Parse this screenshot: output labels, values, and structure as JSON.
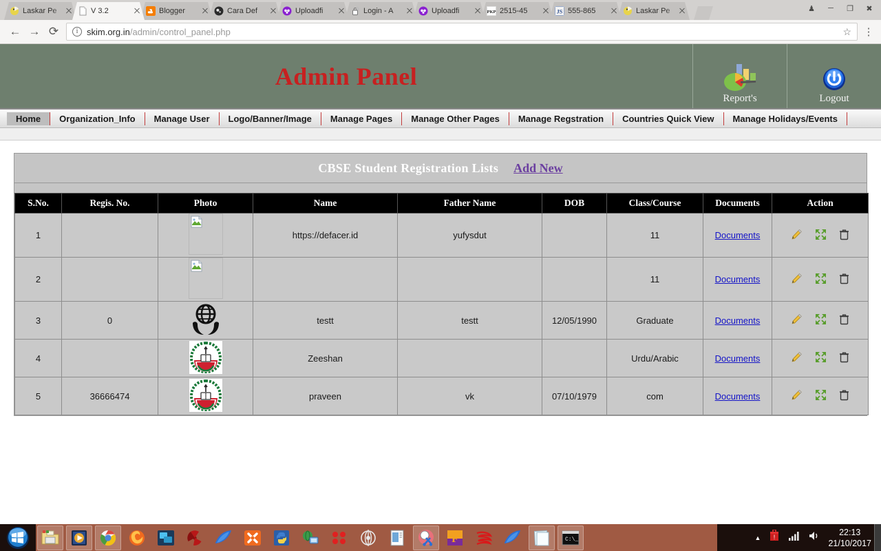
{
  "browser": {
    "tabs": [
      {
        "title": "Laskar Pe",
        "favicon": "laskar-icon",
        "active": false
      },
      {
        "title": "V 3.2",
        "favicon": "document-icon",
        "active": true
      },
      {
        "title": "Blogger",
        "favicon": "blogger-icon",
        "active": false
      },
      {
        "title": "Cara Def",
        "favicon": "dark-circle-icon",
        "active": false
      },
      {
        "title": "Uploadfi",
        "favicon": "uploadfiles-icon",
        "active": false
      },
      {
        "title": "Login - A",
        "favicon": "lock-icon",
        "active": false
      },
      {
        "title": "Uploadfi",
        "favicon": "uploadfiles-icon",
        "active": false
      },
      {
        "title": "2515-45",
        "favicon": "pkp-icon",
        "active": false
      },
      {
        "title": "555-865",
        "favicon": "js-icon",
        "active": false
      },
      {
        "title": "Laskar Pe",
        "favicon": "laskar-icon",
        "active": false
      }
    ],
    "window_controls": [
      "profile-icon",
      "minimize-icon",
      "maximize-icon",
      "close-icon"
    ],
    "nav": {
      "back": "←",
      "forward": "→",
      "reload": "⟳"
    },
    "omnibox": {
      "host": "skim.org.in",
      "path": "/admin/control_panel.php",
      "info_glyph": "i",
      "star_glyph": "☆"
    },
    "menu_glyph": "⋮"
  },
  "site": {
    "title": "Admin Panel",
    "header_buttons": [
      {
        "label": "Report's",
        "icon": "report-chart-icon"
      },
      {
        "label": "Logout",
        "icon": "power-icon"
      }
    ],
    "nav_items": [
      {
        "label": "Home",
        "active": true
      },
      {
        "label": "Organization_Info",
        "active": false
      },
      {
        "label": "Manage User",
        "active": false
      },
      {
        "label": "Logo/Banner/Image",
        "active": false
      },
      {
        "label": "Manage Pages",
        "active": false
      },
      {
        "label": "Manage Other Pages",
        "active": false
      },
      {
        "label": "Manage Regstration",
        "active": false
      },
      {
        "label": "Countries Quick View",
        "active": false
      },
      {
        "label": "Manage Holidays/Events",
        "active": false
      }
    ]
  },
  "panel": {
    "title": "CBSE Student Registration Lists",
    "add_new_label": "Add New"
  },
  "table": {
    "headers": [
      "S.No.",
      "Regis. No.",
      "Photo",
      "Name",
      "Father Name",
      "DOB",
      "Class/Course",
      "Documents",
      "Action"
    ],
    "docs_label": "Documents",
    "rows": [
      {
        "sno": "1",
        "regno": "",
        "photo": "broken-image",
        "name": "https://defacer.id",
        "father": "yufysdut",
        "dob": "",
        "class": "11"
      },
      {
        "sno": "2",
        "regno": "",
        "photo": "broken-image",
        "name": "",
        "father": "",
        "dob": "",
        "class": "11"
      },
      {
        "sno": "3",
        "regno": "0",
        "photo": "globe-hands-logo",
        "name": "testt",
        "father": "testt",
        "dob": "12/05/1990",
        "class": "Graduate"
      },
      {
        "sno": "4",
        "regno": "",
        "photo": "emblem-logo",
        "name": "Zeeshan",
        "father": "",
        "dob": "",
        "class": "Urdu/Arabic"
      },
      {
        "sno": "5",
        "regno": "36666474",
        "photo": "emblem-logo",
        "name": "praveen",
        "father": "vk",
        "dob": "07/10/1979",
        "class": "com"
      }
    ],
    "action_icons": [
      "edit-pencil-icon",
      "expand-arrows-icon",
      "delete-trash-icon"
    ]
  },
  "taskbar": {
    "start": "windows-start-orb",
    "items": [
      {
        "icon": "file-explorer-icon",
        "pinned": true
      },
      {
        "icon": "media-player-icon",
        "pinned": true
      },
      {
        "icon": "chrome-icon",
        "pinned": true
      },
      {
        "icon": "firefox-icon",
        "pinned": false
      },
      {
        "icon": "blue-window-icon",
        "pinned": false
      },
      {
        "icon": "radiation-icon",
        "pinned": false
      },
      {
        "icon": "wireshark-icon",
        "pinned": false
      },
      {
        "icon": "xampp-icon",
        "pinned": false
      },
      {
        "icon": "python-icon",
        "pinned": false
      },
      {
        "icon": "network-globe-icon",
        "pinned": false
      },
      {
        "icon": "red-dots-icon",
        "pinned": false
      },
      {
        "icon": "tor-icon",
        "pinned": false
      },
      {
        "icon": "notepad-icon",
        "pinned": false
      },
      {
        "icon": "snipping-tool-icon",
        "pinned": true
      },
      {
        "icon": "filezilla-icon",
        "pinned": false
      },
      {
        "icon": "red-swirl-icon",
        "pinned": false
      },
      {
        "icon": "wireshark-icon",
        "pinned": false
      },
      {
        "icon": "sticky-notes-icon",
        "pinned": true
      },
      {
        "icon": "command-prompt-icon",
        "pinned": true
      }
    ],
    "tray": {
      "overflow_glyph": "▲",
      "icons": [
        "antivirus-icon",
        "network-signal-icon",
        "volume-icon"
      ],
      "time": "22:13",
      "date": "21/10/2017"
    }
  },
  "colors": {
    "header_bg": "#6e7f6e",
    "title_red": "#c72020",
    "link_purple": "#6b3fa0",
    "link_blue": "#1414c8",
    "table_row_bg": "#c9c9c9",
    "taskbar_accent": "#a05a43"
  }
}
